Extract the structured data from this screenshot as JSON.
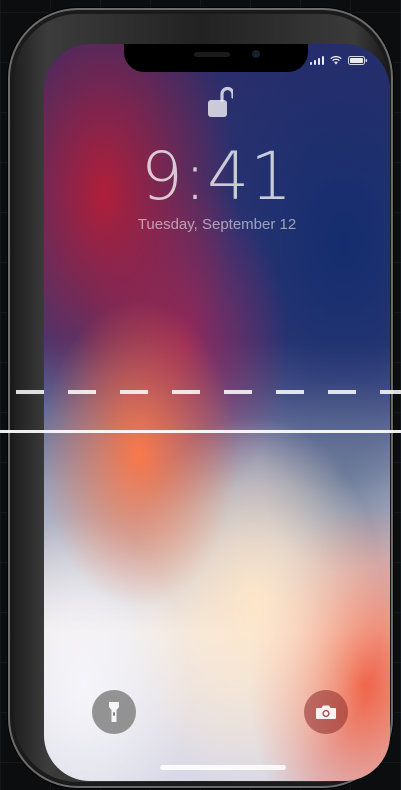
{
  "lock_screen": {
    "time": "9:41",
    "date": "Tuesday, September 12"
  },
  "icons": {
    "lock": "unlocked-padlock-icon",
    "flashlight": "flashlight-icon",
    "camera": "camera-icon",
    "signal": "cellular-signal-icon",
    "wifi": "wifi-icon",
    "battery": "battery-icon"
  },
  "colors": {
    "wallpaper_red": "#b01e3a",
    "wallpaper_blue": "#142d6e",
    "wallpaper_orange": "#ff7846",
    "page_background": "#0b0d0f"
  }
}
